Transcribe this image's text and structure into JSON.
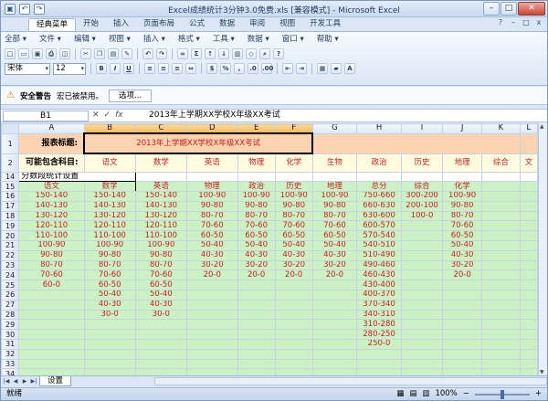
{
  "window": {
    "title": "Excel成绩统计3分钟3.0免费.xls  [兼容模式] - Microsoft Excel",
    "controls": [
      "–",
      "□",
      "✕"
    ]
  },
  "qat": {
    "icons": [
      "save-icon",
      "undo-icon",
      "redo-icon"
    ],
    "glyphs": [
      "▣",
      "↶",
      "↷"
    ]
  },
  "ribbon": {
    "tabs": [
      "经典菜单",
      "开始",
      "插入",
      "页面布局",
      "公式",
      "数据",
      "审阅",
      "视图",
      "开发工具"
    ],
    "menus": [
      "全部 ▾",
      "文件 ▾",
      "编辑 ▾",
      "视图 ▾",
      "插入 ▾",
      "格式 ▾",
      "工具 ▾",
      "数据 ▾",
      "窗口 ▾",
      "帮助 ▾"
    ],
    "font": "宋体",
    "font_size": "12",
    "bold": "B",
    "italic": "I",
    "underline": "U"
  },
  "security": {
    "label": "安全警告",
    "message": "宏已被禁用。",
    "options_button": "选项..."
  },
  "formula": {
    "name_box": "B1",
    "fx": "fx",
    "value": "2013年上学期XX学校X年级XX考试"
  },
  "columns": [
    "A",
    "B",
    "C",
    "D",
    "E",
    "F",
    "G",
    "H",
    "I",
    "J",
    "K",
    "L"
  ],
  "row1": {
    "num": "1",
    "label": "报表标题:",
    "title": "2013年上学期XX学校X年级XX考试"
  },
  "row2": {
    "num": "2",
    "label": "可能包含科目:",
    "subjects": [
      "语文",
      "数学",
      "英语",
      "物理",
      "化学",
      "生物",
      "政治",
      "历史",
      "地理",
      "综合",
      "文"
    ]
  },
  "row14": {
    "num": "14",
    "label": "分数段统计设置"
  },
  "rows": [
    {
      "num": "15",
      "cells": [
        "语文",
        "数学",
        "英语",
        "物理",
        "政治",
        "历史",
        "地理",
        "总分",
        "综合",
        "化学",
        ""
      ]
    },
    {
      "num": "16",
      "cells": [
        "150-140",
        "150-140",
        "150-140",
        "100-90",
        "100-90",
        "100-90",
        "100-90",
        "750-660",
        "300-200",
        "100-90",
        ""
      ]
    },
    {
      "num": "17",
      "cells": [
        "140-130",
        "140-130",
        "140-130",
        "90-80",
        "90-80",
        "90-80",
        "90-80",
        "660-630",
        "200-100",
        "90-80",
        ""
      ]
    },
    {
      "num": "18",
      "cells": [
        "130-120",
        "130-120",
        "130-120",
        "80-70",
        "80-70",
        "80-70",
        "80-70",
        "630-600",
        "100-0",
        "80-70",
        ""
      ]
    },
    {
      "num": "19",
      "cells": [
        "120-110",
        "120-110",
        "120-110",
        "70-60",
        "70-60",
        "70-60",
        "70-60",
        "600-570",
        "",
        "70-60",
        ""
      ]
    },
    {
      "num": "20",
      "cells": [
        "110-100",
        "110-100",
        "110-100",
        "60-50",
        "60-50",
        "60-50",
        "60-50",
        "570-540",
        "",
        "60-50",
        ""
      ]
    },
    {
      "num": "21",
      "cells": [
        "100-90",
        "100-90",
        "100-90",
        "50-40",
        "50-40",
        "50-40",
        "50-40",
        "540-510",
        "",
        "50-40",
        ""
      ]
    },
    {
      "num": "22",
      "cells": [
        "90-80",
        "90-80",
        "90-80",
        "40-30",
        "40-30",
        "40-30",
        "40-30",
        "510-490",
        "",
        "40-30",
        ""
      ]
    },
    {
      "num": "23",
      "cells": [
        "80-70",
        "80-70",
        "80-70",
        "30-20",
        "30-20",
        "30-20",
        "30-20",
        "490-460",
        "",
        "30-20",
        ""
      ]
    },
    {
      "num": "24",
      "cells": [
        "70-60",
        "70-60",
        "70-60",
        "20-0",
        "20-0",
        "20-0",
        "20-0",
        "460-430",
        "",
        "20-0",
        ""
      ]
    },
    {
      "num": "25",
      "cells": [
        "60-0",
        "60-50",
        "60-50",
        "",
        "",
        "",
        "",
        "430-400",
        "",
        "",
        ""
      ]
    },
    {
      "num": "26",
      "cells": [
        "",
        "50-40",
        "50-40",
        "",
        "",
        "",
        "",
        "400-370",
        "",
        "",
        ""
      ]
    },
    {
      "num": "27",
      "cells": [
        "",
        "40-30",
        "40-30",
        "",
        "",
        "",
        "",
        "370-340",
        "",
        "",
        ""
      ]
    },
    {
      "num": "28",
      "cells": [
        "",
        "30-0",
        "30-0",
        "",
        "",
        "",
        "",
        "340-310",
        "",
        "",
        ""
      ]
    },
    {
      "num": "29",
      "cells": [
        "",
        "",
        "",
        "",
        "",
        "",
        "",
        "310-280",
        "",
        "",
        ""
      ]
    },
    {
      "num": "30",
      "cells": [
        "",
        "",
        "",
        "",
        "",
        "",
        "",
        "280-250",
        "",
        "",
        ""
      ]
    },
    {
      "num": "31",
      "cells": [
        "",
        "",
        "",
        "",
        "",
        "",
        "",
        "250-0",
        "",
        "",
        ""
      ]
    },
    {
      "num": "32",
      "cells": [
        "",
        "",
        "",
        "",
        "",
        "",
        "",
        "",
        "",
        "",
        ""
      ]
    },
    {
      "num": "33",
      "cells": [
        "",
        "",
        "",
        "",
        "",
        "",
        "",
        "",
        "",
        "",
        ""
      ]
    },
    {
      "num": "34",
      "cells": [
        "",
        "",
        "",
        "",
        "",
        "",
        "",
        "",
        "",
        "",
        ""
      ]
    }
  ],
  "sheet_tab": "设置",
  "status": {
    "text": "就绪",
    "zoom": "100%"
  }
}
